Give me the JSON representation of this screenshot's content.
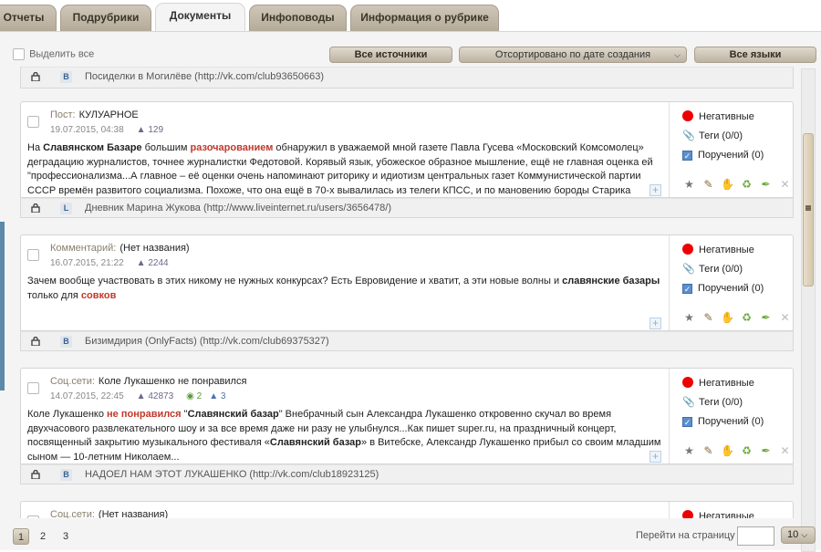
{
  "tabs": [
    {
      "label": "Отчеты"
    },
    {
      "label": "Подрубрики"
    },
    {
      "label": "Документы"
    },
    {
      "label": "Инфоповоды"
    },
    {
      "label": "Информация о рубрике"
    }
  ],
  "toolbar": {
    "select_all": "Выделить все",
    "all_sources": "Все источники",
    "sort": "Отсортировано по дате создания",
    "all_languages": "Все языки"
  },
  "top_source": "Посиделки в Могилёве (http://vk.com/club93650663)",
  "documents": [
    {
      "type": "Пост:",
      "title": "КУЛУАРНОЕ",
      "date": "19.07.2015, 04:38",
      "views": "129",
      "comments": "",
      "likes": "",
      "body_parts": [
        {
          "t": "На ",
          "s": "n"
        },
        {
          "t": "Славянском Базаре",
          "s": "b"
        },
        {
          "t": " большим ",
          "s": "n"
        },
        {
          "t": "разочарованием",
          "s": "h"
        },
        {
          "t": " обнаружил в уважаемой мной газете Павла Гусева «Московский Комсомолец» деградацию журналистов, точнее журналистки Федотовой. Корявый язык, убожеское образное мышление, ещё не главная оценка ей \"профессионализма...А главное – её оценки очень напоминают риторику и идиотизм центральных газет Коммунистической партии СССР времён развитого социализма. Похоже, что она ещё в 70-х вывалилась из телеги КПСС, и по мановению бороды Старика",
          "s": "n"
        }
      ],
      "tonality": "Негативные",
      "tags": "Теги (0/0)",
      "tasks": "Поручений (0)",
      "source": "Дневник Марина Жукова (http://www.liveinternet.ru/users/3656478/)",
      "source_icon": "L"
    },
    {
      "type": "Комментарий:",
      "title": "(Нет названия)",
      "date": "16.07.2015, 21:22",
      "views": "2244",
      "comments": "",
      "likes": "",
      "body_parts": [
        {
          "t": "Зачем вообще участвовать в этих никому не нужных конкурсах? Есть Евровидение и хватит, а эти новые волны и ",
          "s": "n"
        },
        {
          "t": "славянские базары",
          "s": "b"
        },
        {
          "t": " только для ",
          "s": "n"
        },
        {
          "t": "совков",
          "s": "h"
        }
      ],
      "tonality": "Негативные",
      "tags": "Теги (0/0)",
      "tasks": "Поручений (0)",
      "source": "Бизимдирия (OnlyFacts) (http://vk.com/club69375327)",
      "source_icon": "B"
    },
    {
      "type": "Соц.сети:",
      "title": "Коле Лукашенко не понравился",
      "date": "14.07.2015, 22:45",
      "views": "42873",
      "comments": "2",
      "likes": "3",
      "body_parts": [
        {
          "t": "Коле Лукашенко ",
          "s": "n"
        },
        {
          "t": "не понравился",
          "s": "h"
        },
        {
          "t": " \"",
          "s": "n"
        },
        {
          "t": "Славянский базар",
          "s": "b"
        },
        {
          "t": "\"   Внебрачный сын Александра Лукашенко откровенно скучал во время двухчасового развлекательного шоу и за все время даже ни разу не улыбнулся...Как пишет super.ru, на праздничный концерт, посвященный закрытию музыкального фестиваля «",
          "s": "n"
        },
        {
          "t": "Славянский базар",
          "s": "b"
        },
        {
          "t": "» в Витебске, Александр Лукашенко прибыл со своим младшим сыном — 10-летним Николаем...",
          "s": "n"
        }
      ],
      "tonality": "Негативные",
      "tags": "Теги (0/0)",
      "tasks": "Поручений (0)",
      "source": "НАДОЕЛ НАМ ЭТОТ ЛУКАШЕНКО (http://vk.com/club18923125)",
      "source_icon": "B"
    },
    {
      "type": "Соц.сети:",
      "title": "(Нет названия)",
      "tonality": "Негативные"
    }
  ],
  "pager": {
    "pages": [
      "1",
      "2",
      "3"
    ],
    "goto_label": "Перейти на страницу",
    "goto_value": "",
    "per_page": "10"
  },
  "colors": {
    "accent": "#c0392b",
    "tab_bg": "#bdb3a3",
    "negative_dot": "#ee0000"
  }
}
